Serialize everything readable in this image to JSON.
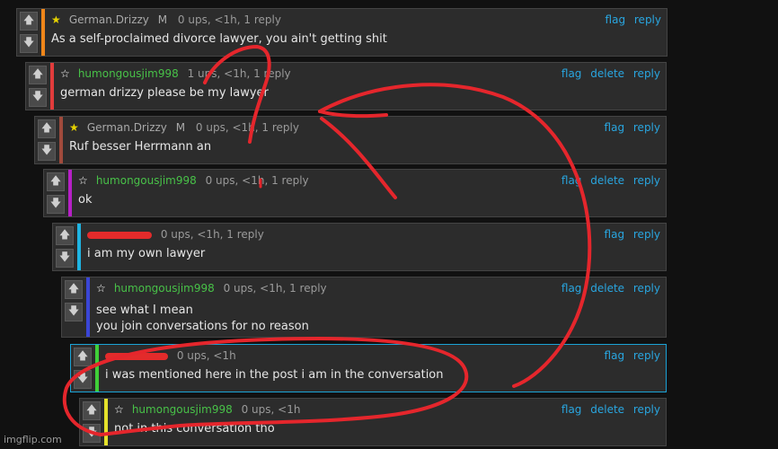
{
  "actions": {
    "flag": "flag",
    "delete": "delete",
    "reply": "reply"
  },
  "vote_up": "🡅",
  "vote_down": "🡇",
  "comments": [
    {
      "user": "German.Drizzy",
      "rank": "M",
      "info": "0 ups, <1h, 1 reply",
      "text": "As a self-proclaimed divorce lawyer, you ain't getting shit",
      "bar_color": "#f0861a",
      "star": "gold"
    },
    {
      "user": "humongousjim998",
      "info": "1 ups, <1h, 1 reply",
      "text": "german drizzy please be my lawyer",
      "bar_color": "#e23c3c",
      "star": "white"
    },
    {
      "user": "German.Drizzy",
      "rank": "M",
      "info": "0 ups, <1h, 1 reply",
      "text": "Ruf besser Herrmann an",
      "bar_color": "#a04a3c",
      "star": "gold"
    },
    {
      "user": "humongousjim998",
      "info": "0 ups, <1h, 1 reply",
      "text": "ok",
      "bar_color": "#b620c6",
      "star": "white"
    },
    {
      "user": "",
      "info": "0 ups, <1h, 1 reply",
      "text": "i am my own lawyer",
      "bar_color": "#1fb4e2",
      "star": ""
    },
    {
      "user": "humongousjim998",
      "info": "0 ups, <1h, 1 reply",
      "text_line1": "see what I mean",
      "text_line2": "you join conversations for no reason",
      "bar_color": "#3a46d6",
      "star": "white"
    },
    {
      "user": "",
      "info": "0 ups, <1h",
      "text": "i was mentioned here in the post i am in the conversation",
      "bar_color": "#3fcf38",
      "star": ""
    },
    {
      "user": "humongousjim998",
      "info": "0 ups, <1h",
      "text": "not in this conversation tho",
      "bar_color": "#e5e22b",
      "star": "white"
    }
  ],
  "watermark": "imgflip.com"
}
